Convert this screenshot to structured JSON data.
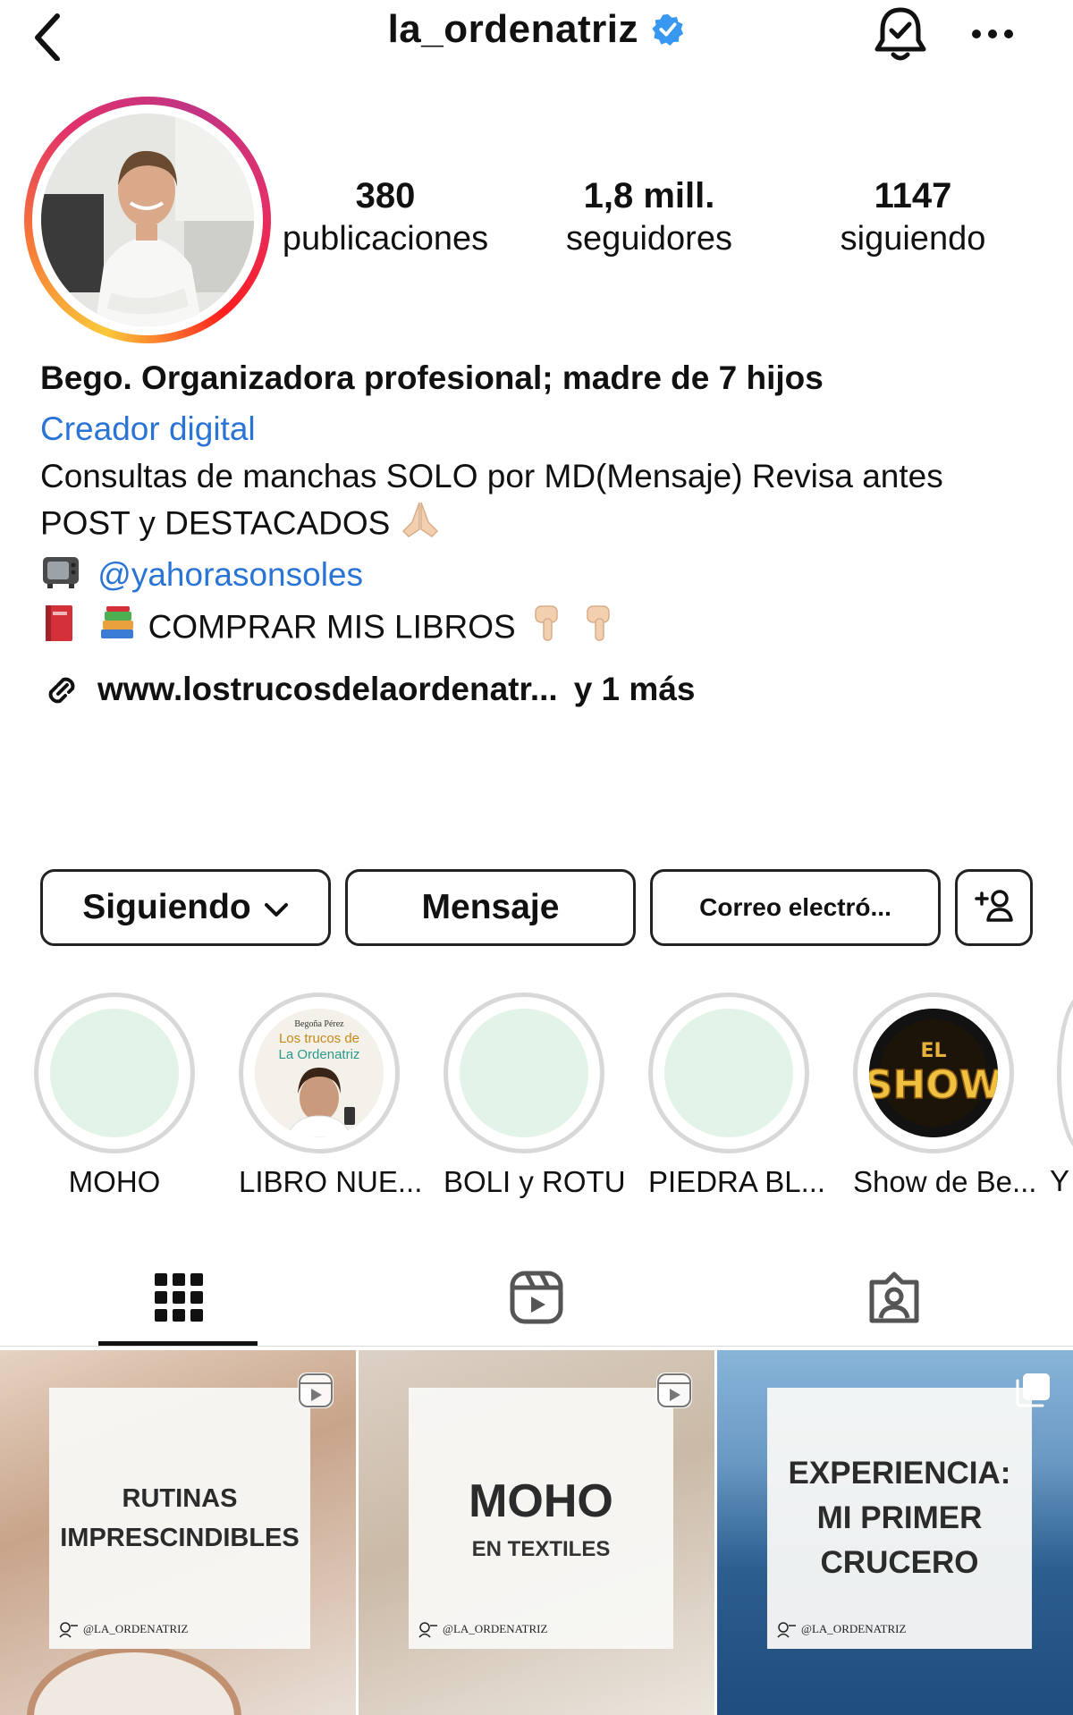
{
  "header": {
    "username": "la_ordenatriz"
  },
  "stats": {
    "posts_count": "380",
    "posts_label": "publicaciones",
    "followers_count": "1,8 mill.",
    "followers_label": "seguidores",
    "following_count": "1147",
    "following_label": "siguiendo"
  },
  "bio": {
    "name": "Bego. Organizadora profesional; madre de 7 hijos",
    "category": "Creador digital",
    "text_line1": "Consultas de manchas SOLO por MD(Mensaje) Revisa antes",
    "text_line2": "POST y DESTACADOS",
    "mention": "@yahorasonsoles",
    "books_text": "COMPRAR MIS LIBROS",
    "link": "www.lostrucosdelaordenatr...",
    "link_more": "y 1 más"
  },
  "buttons": {
    "following": "Siguiendo",
    "message": "Mensaje",
    "email": "Correo electró..."
  },
  "highlights": [
    {
      "label": "MOHO"
    },
    {
      "label": "LIBRO NUE..."
    },
    {
      "label": "BOLI y ROTU"
    },
    {
      "label": "PIEDRA BL..."
    },
    {
      "label": "Show de Be..."
    },
    {
      "label": "Y"
    }
  ],
  "highlight_book": {
    "author": "Begoña Pérez",
    "title_line1": "Los trucos de",
    "title_line2": "La Ordenatriz"
  },
  "highlight_show": {
    "top": "EL",
    "word": "SHOW"
  },
  "posts": [
    {
      "title_line1": "RUTINAS",
      "title_line2": "IMPRESCINDIBLES",
      "watermark": "@LA_ORDENATRIZ",
      "badge": "reel-icon"
    },
    {
      "title": "MOHO",
      "subtitle": "EN TEXTILES",
      "watermark": "@LA_ORDENATRIZ",
      "badge": "reel-icon"
    },
    {
      "title_line1": "EXPERIENCIA:",
      "title_line2": "MI PRIMER",
      "title_line3": "CRUCERO",
      "watermark": "@LA_ORDENATRIZ",
      "badge": "carousel-icon"
    }
  ],
  "colors": {
    "link_blue": "#2a74d6",
    "verified_blue": "#3897f0",
    "highlight_fill": "#e2f4e8"
  }
}
